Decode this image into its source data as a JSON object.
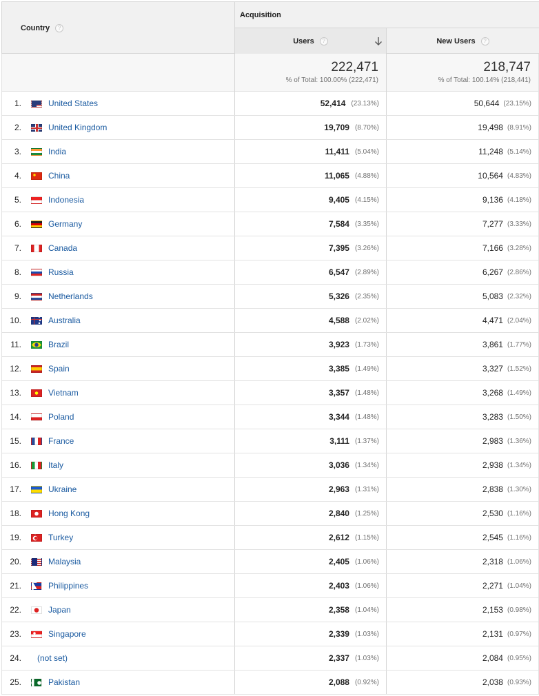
{
  "header": {
    "country_label": "Country",
    "group_label": "Acquisition",
    "users_label": "Users",
    "new_users_label": "New Users",
    "help_glyph": "?"
  },
  "totals": {
    "users": "222,471",
    "users_pct": "% of Total: 100.00% (222,471)",
    "new_users": "218,747",
    "new_users_pct": "% of Total: 100.14% (218,441)"
  },
  "rows": [
    {
      "idx": "1.",
      "country": "United States",
      "flag": "us-flag-icon",
      "users": "52,414",
      "users_pct": "(23.13%)",
      "new_users": "50,644",
      "new_pct": "(23.15%)"
    },
    {
      "idx": "2.",
      "country": "United Kingdom",
      "flag": "uk-flag-icon",
      "users": "19,709",
      "users_pct": "(8.70%)",
      "new_users": "19,498",
      "new_pct": "(8.91%)"
    },
    {
      "idx": "3.",
      "country": "India",
      "flag": "india-flag-icon",
      "users": "11,411",
      "users_pct": "(5.04%)",
      "new_users": "11,248",
      "new_pct": "(5.14%)"
    },
    {
      "idx": "4.",
      "country": "China",
      "flag": "china-flag-icon",
      "users": "11,065",
      "users_pct": "(4.88%)",
      "new_users": "10,564",
      "new_pct": "(4.83%)"
    },
    {
      "idx": "5.",
      "country": "Indonesia",
      "flag": "indonesia-flag-icon",
      "users": "9,405",
      "users_pct": "(4.15%)",
      "new_users": "9,136",
      "new_pct": "(4.18%)"
    },
    {
      "idx": "6.",
      "country": "Germany",
      "flag": "germany-flag-icon",
      "users": "7,584",
      "users_pct": "(3.35%)",
      "new_users": "7,277",
      "new_pct": "(3.33%)"
    },
    {
      "idx": "7.",
      "country": "Canada",
      "flag": "canada-flag-icon",
      "users": "7,395",
      "users_pct": "(3.26%)",
      "new_users": "7,166",
      "new_pct": "(3.28%)"
    },
    {
      "idx": "8.",
      "country": "Russia",
      "flag": "russia-flag-icon",
      "users": "6,547",
      "users_pct": "(2.89%)",
      "new_users": "6,267",
      "new_pct": "(2.86%)"
    },
    {
      "idx": "9.",
      "country": "Netherlands",
      "flag": "netherlands-flag-icon",
      "users": "5,326",
      "users_pct": "(2.35%)",
      "new_users": "5,083",
      "new_pct": "(2.32%)"
    },
    {
      "idx": "10.",
      "country": "Australia",
      "flag": "australia-flag-icon",
      "users": "4,588",
      "users_pct": "(2.02%)",
      "new_users": "4,471",
      "new_pct": "(2.04%)"
    },
    {
      "idx": "11.",
      "country": "Brazil",
      "flag": "brazil-flag-icon",
      "users": "3,923",
      "users_pct": "(1.73%)",
      "new_users": "3,861",
      "new_pct": "(1.77%)"
    },
    {
      "idx": "12.",
      "country": "Spain",
      "flag": "spain-flag-icon",
      "users": "3,385",
      "users_pct": "(1.49%)",
      "new_users": "3,327",
      "new_pct": "(1.52%)"
    },
    {
      "idx": "13.",
      "country": "Vietnam",
      "flag": "vietnam-flag-icon",
      "users": "3,357",
      "users_pct": "(1.48%)",
      "new_users": "3,268",
      "new_pct": "(1.49%)"
    },
    {
      "idx": "14.",
      "country": "Poland",
      "flag": "poland-flag-icon",
      "users": "3,344",
      "users_pct": "(1.48%)",
      "new_users": "3,283",
      "new_pct": "(1.50%)"
    },
    {
      "idx": "15.",
      "country": "France",
      "flag": "france-flag-icon",
      "users": "3,111",
      "users_pct": "(1.37%)",
      "new_users": "2,983",
      "new_pct": "(1.36%)"
    },
    {
      "idx": "16.",
      "country": "Italy",
      "flag": "italy-flag-icon",
      "users": "3,036",
      "users_pct": "(1.34%)",
      "new_users": "2,938",
      "new_pct": "(1.34%)"
    },
    {
      "idx": "17.",
      "country": "Ukraine",
      "flag": "ukraine-flag-icon",
      "users": "2,963",
      "users_pct": "(1.31%)",
      "new_users": "2,838",
      "new_pct": "(1.30%)"
    },
    {
      "idx": "18.",
      "country": "Hong Kong",
      "flag": "hong-kong-flag-icon",
      "users": "2,840",
      "users_pct": "(1.25%)",
      "new_users": "2,530",
      "new_pct": "(1.16%)"
    },
    {
      "idx": "19.",
      "country": "Turkey",
      "flag": "turkey-flag-icon",
      "users": "2,612",
      "users_pct": "(1.15%)",
      "new_users": "2,545",
      "new_pct": "(1.16%)"
    },
    {
      "idx": "20.",
      "country": "Malaysia",
      "flag": "malaysia-flag-icon",
      "users": "2,405",
      "users_pct": "(1.06%)",
      "new_users": "2,318",
      "new_pct": "(1.06%)"
    },
    {
      "idx": "21.",
      "country": "Philippines",
      "flag": "philippines-flag-icon",
      "users": "2,403",
      "users_pct": "(1.06%)",
      "new_users": "2,271",
      "new_pct": "(1.04%)"
    },
    {
      "idx": "22.",
      "country": "Japan",
      "flag": "japan-flag-icon",
      "users": "2,358",
      "users_pct": "(1.04%)",
      "new_users": "2,153",
      "new_pct": "(0.98%)"
    },
    {
      "idx": "23.",
      "country": "Singapore",
      "flag": "singapore-flag-icon",
      "users": "2,339",
      "users_pct": "(1.03%)",
      "new_users": "2,131",
      "new_pct": "(0.97%)"
    },
    {
      "idx": "24.",
      "country": "(not set)",
      "flag": "",
      "users": "2,337",
      "users_pct": "(1.03%)",
      "new_users": "2,084",
      "new_pct": "(0.95%)"
    },
    {
      "idx": "25.",
      "country": "Pakistan",
      "flag": "pakistan-flag-icon",
      "users": "2,088",
      "users_pct": "(0.92%)",
      "new_users": "2,038",
      "new_pct": "(0.93%)"
    }
  ],
  "colors": {
    "link": "#1a5aa0",
    "header_bg": "#f1f1f1",
    "sorted_col_bg": "#e9e9e9",
    "border": "#d6d6d6"
  }
}
